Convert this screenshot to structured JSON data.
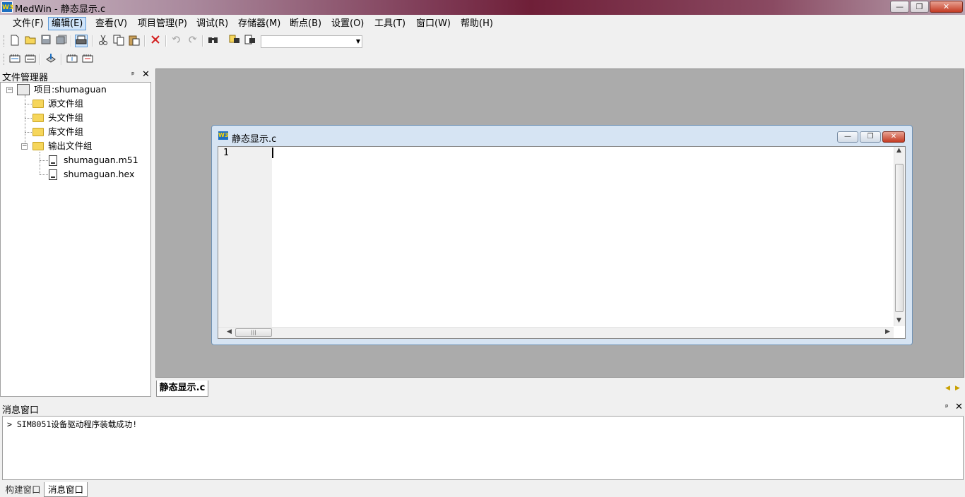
{
  "window": {
    "title": "MedWin - 静态显示.c",
    "icon_text": "W3",
    "controls": {
      "minimize": "—",
      "maximize": "❐",
      "close": "✕"
    }
  },
  "menu": [
    "文件(F)",
    "编辑(E)",
    "查看(V)",
    "项目管理(P)",
    "调试(R)",
    "存储器(M)",
    "断点(B)",
    "设置(O)",
    "工具(T)",
    "窗口(W)",
    "帮助(H)"
  ],
  "menu_active_index": 1,
  "file_manager": {
    "title": "文件管理器",
    "pin": "ᵖ",
    "close": "✕",
    "tree": {
      "expand_minus": "−",
      "project": "项目:shumaguan",
      "groups": [
        "源文件组",
        "头文件组",
        "库文件组",
        "输出文件组"
      ],
      "output_files": [
        "shumaguan.m51",
        "shumaguan.hex"
      ]
    }
  },
  "editor": {
    "child_title": "静态显示.c",
    "child_icon_text": "W3",
    "line_numbers": [
      "1"
    ],
    "content": "",
    "hthumb_grip": "|||"
  },
  "doc_tabs": [
    "静态显示.c"
  ],
  "messages": {
    "title": "消息窗口",
    "lines": [
      "> SIM8051设备驱动程序装载成功!"
    ]
  },
  "bottom_tabs": [
    "构建窗口",
    "消息窗口"
  ],
  "colors": {
    "mdi_background": "#ababab",
    "title_accent": "#6f1f38",
    "menu_highlight": "#cfe4fa",
    "folder": "#f6d65b"
  }
}
